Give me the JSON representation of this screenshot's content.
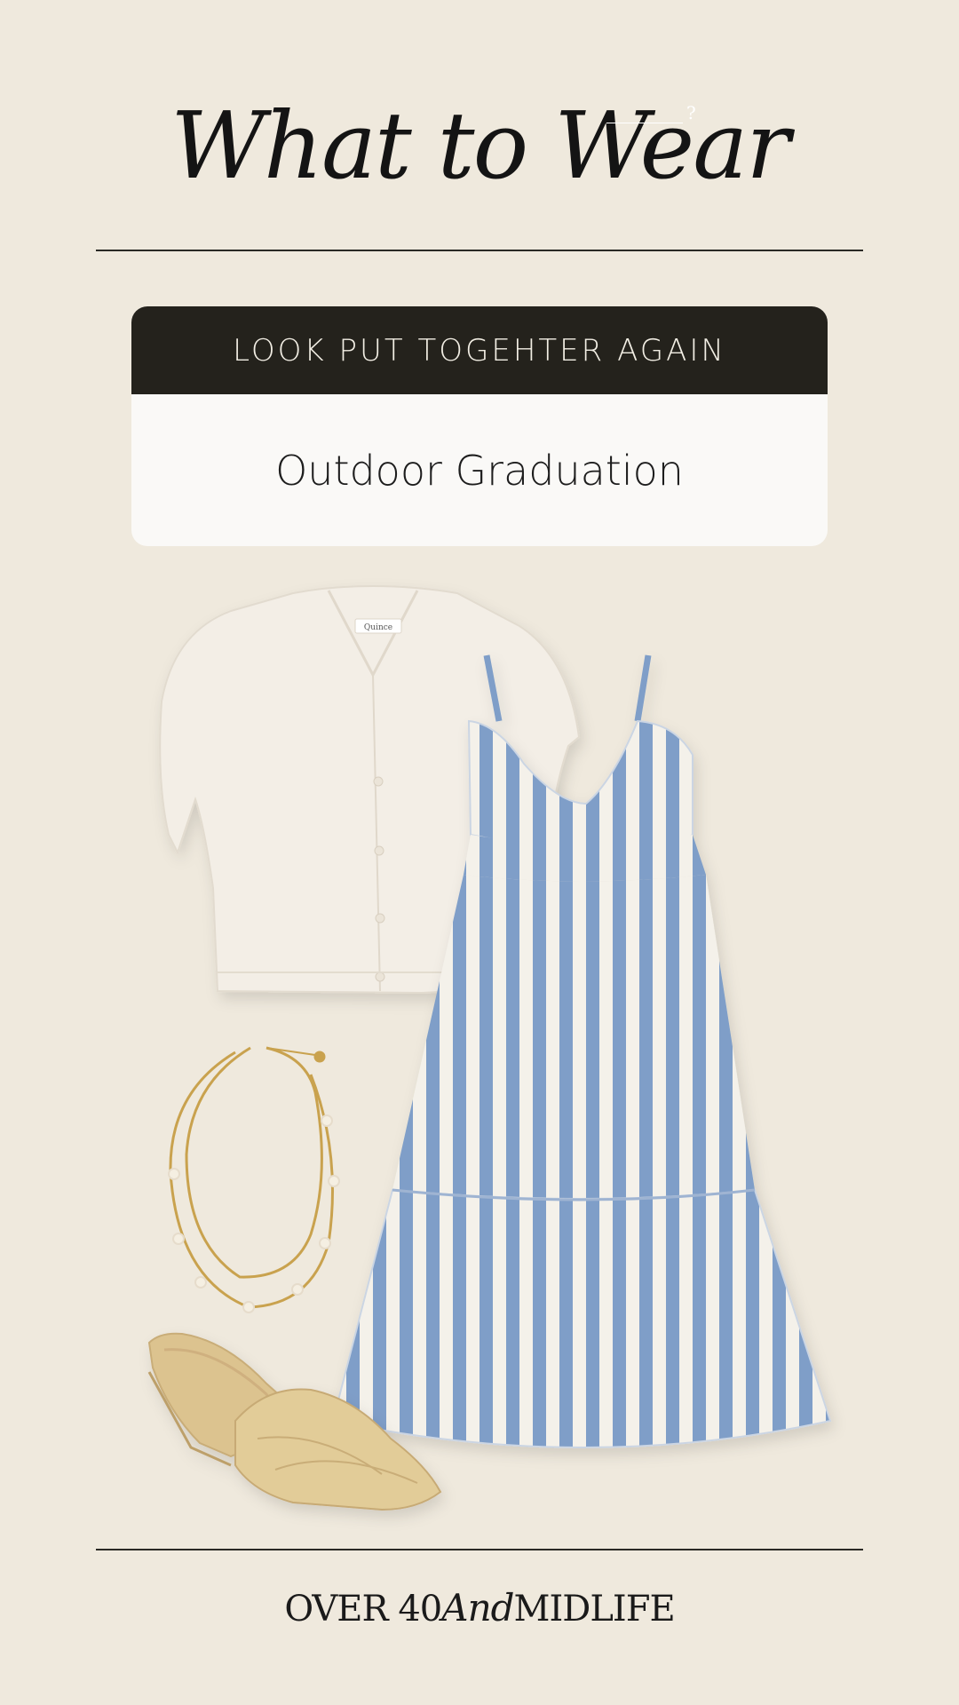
{
  "header": {
    "title": "What to Wear",
    "title_mark": "?"
  },
  "card": {
    "banner": "LOOK PUT TOGEHTER AGAIN",
    "occasion": "Outdoor Graduation"
  },
  "outfit": {
    "items": [
      {
        "icon": "cardigan",
        "label": "Quince",
        "color": "#f3eee6"
      },
      {
        "icon": "striped-dress",
        "color": "#7f9ec8"
      },
      {
        "icon": "necklace",
        "color": "#c9a24e"
      },
      {
        "icon": "wedge-sandal",
        "color": "#dcc38f"
      }
    ]
  },
  "footer": {
    "brand_left": "OVER 40",
    "brand_and": "And",
    "brand_right": "MIDLIFE"
  },
  "colors": {
    "background": "#efe9dd",
    "banner": "#24221c",
    "card": "#faf9f7",
    "text": "#141414"
  }
}
